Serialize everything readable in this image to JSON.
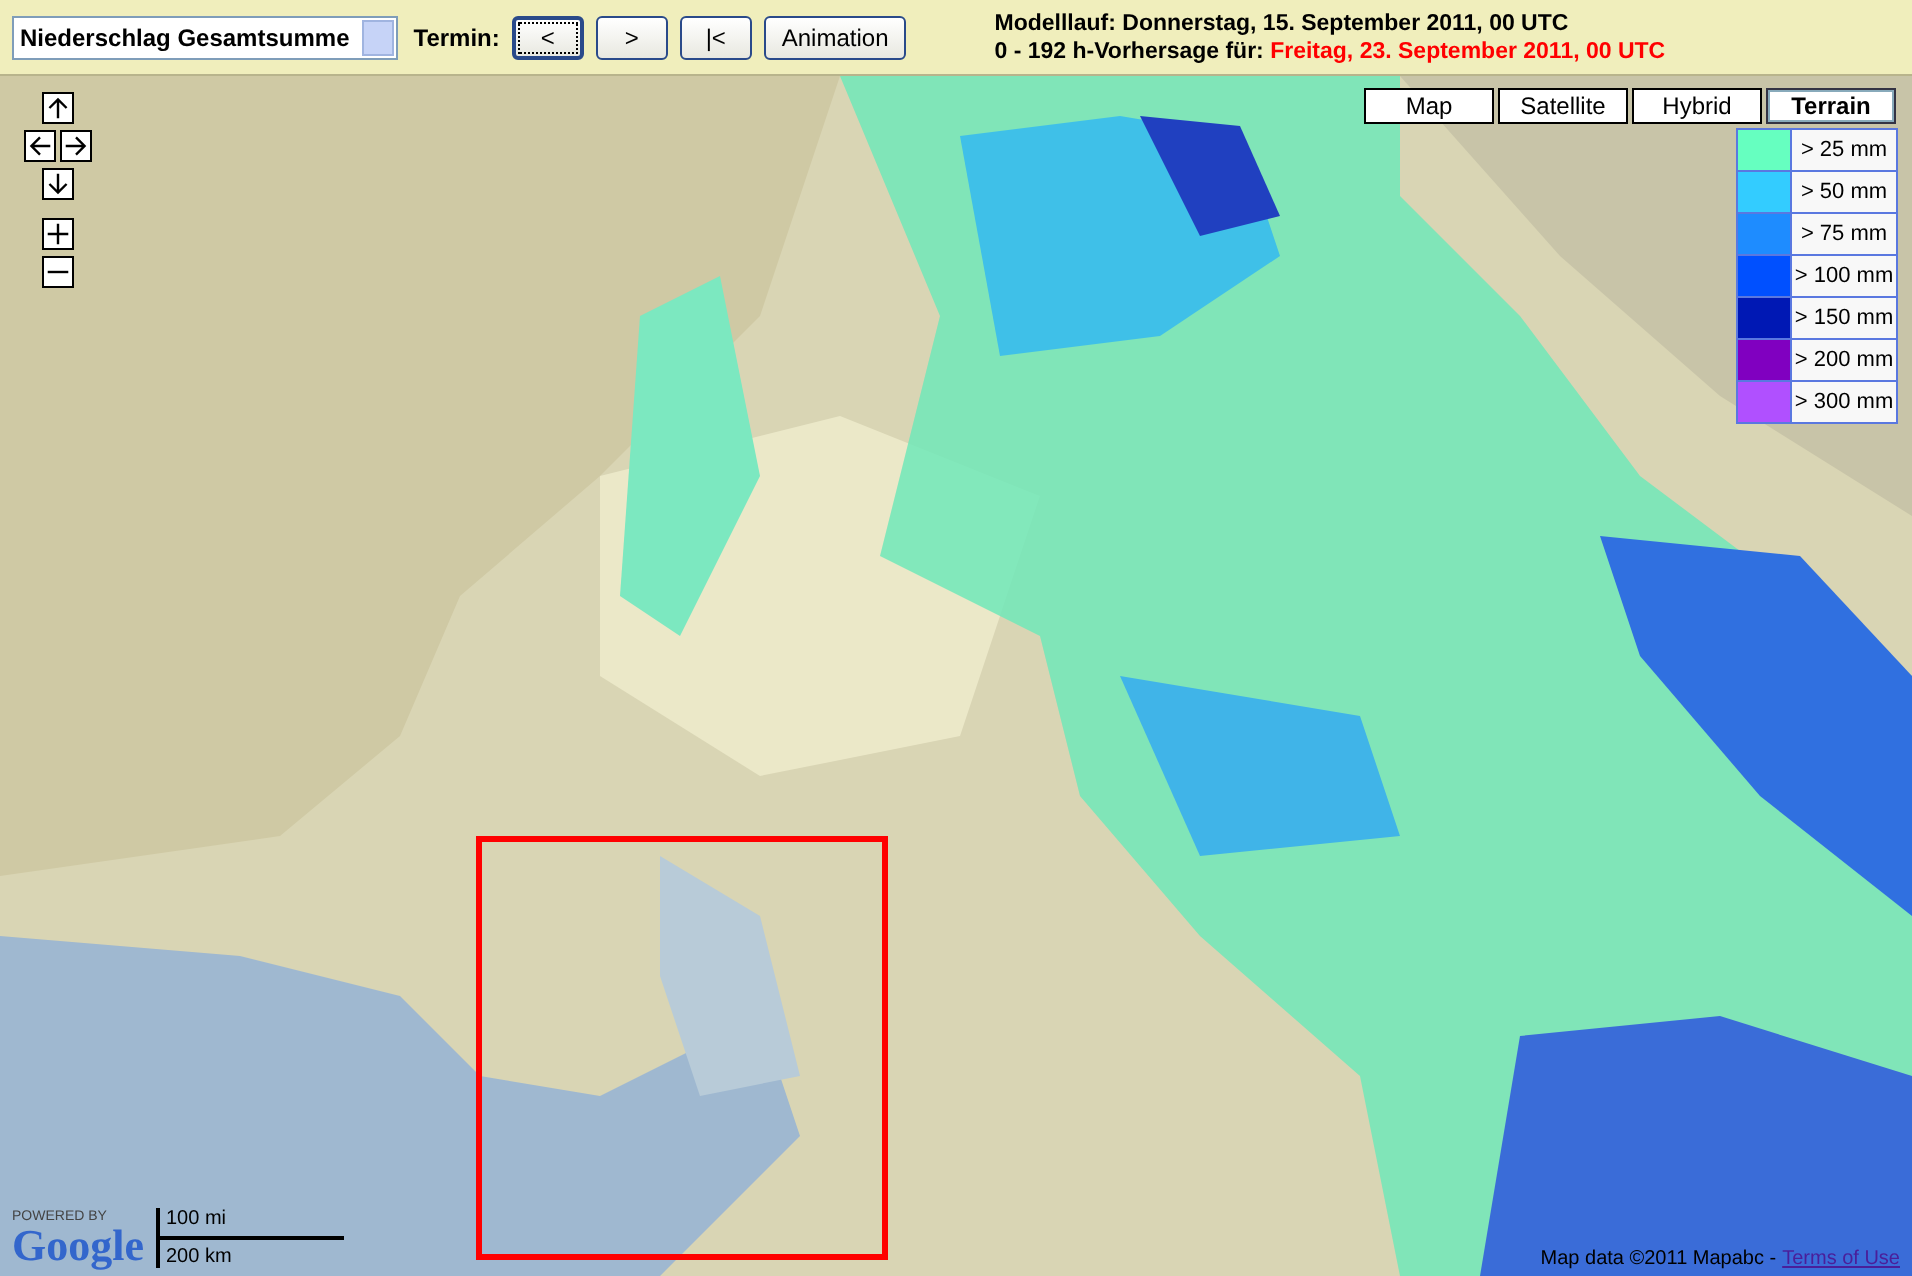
{
  "toolbar": {
    "product_select": {
      "value": "Niederschlag Gesamtsumme"
    },
    "termin_label": "Termin:",
    "buttons": [
      {
        "label": "<",
        "selected": true
      },
      {
        "label": ">",
        "selected": false
      },
      {
        "label": "|<",
        "selected": false
      },
      {
        "label": "Animation",
        "selected": false
      }
    ],
    "model_run": "Modelllauf: Donnerstag, 15. September 2011, 00 UTC",
    "forecast_label": "0 - 192 h-Vorhersage für:",
    "forecast_time": "Freitag, 23. September 2011, 00 UTC"
  },
  "map": {
    "kind": "picture",
    "map_types": [
      {
        "label": "Map",
        "selected": false
      },
      {
        "label": "Satellite",
        "selected": false
      },
      {
        "label": "Hybrid",
        "selected": false
      },
      {
        "label": "Terrain",
        "selected": true
      }
    ],
    "legend": [
      {
        "label": "> 25 mm",
        "color": "#66ffc0"
      },
      {
        "label": "> 50 mm",
        "color": "#33ccff"
      },
      {
        "label": "> 75 mm",
        "color": "#1e8cff"
      },
      {
        "label": "> 100 mm",
        "color": "#0050ff"
      },
      {
        "label": "> 150 mm",
        "color": "#0018b4"
      },
      {
        "label": "> 200 mm",
        "color": "#8000c0"
      },
      {
        "label": "> 300 mm",
        "color": "#b050ff"
      }
    ],
    "powered_by": "POWERED BY",
    "logo": "Google",
    "scale": {
      "miles": "100 mi",
      "km": "200 km"
    },
    "attribution": "Map data ©2011 Mapabc -",
    "terms_link": "Terms of Use"
  }
}
